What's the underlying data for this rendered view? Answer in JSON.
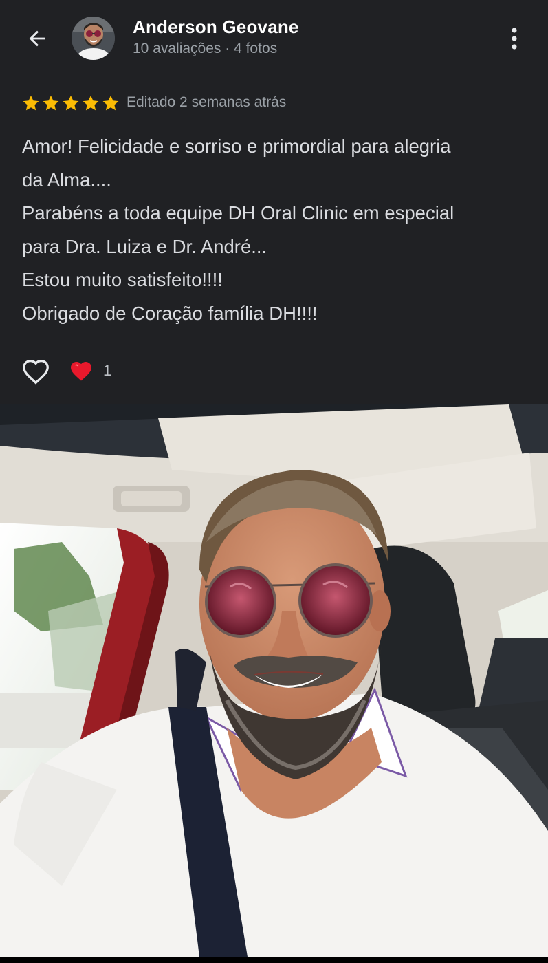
{
  "header": {
    "author_name": "Anderson Geovane",
    "author_meta": "10 avaliações · 4 fotos",
    "back_icon": "arrow-left-icon",
    "more_icon": "more-vertical-icon"
  },
  "rating": {
    "stars": 5,
    "max_stars": 5,
    "edited_label": "Editado 2 semanas atrás",
    "star_color": "#fbbc04"
  },
  "review": {
    "lines": [
      "Amor! Felicidade e sorriso e primordial para alegria",
      "da Alma....",
      "Parabéns a toda equipe DH Oral Clinic em especial",
      "para Dra. Luiza e Dr. André...",
      "Estou muito satisfeito!!!!",
      "Obrigado de Coração família DH!!!!"
    ]
  },
  "reactions": {
    "like_icon": "heart-outline-icon",
    "reaction_icon": "red-heart-icon",
    "count": "1"
  },
  "colors": {
    "panel_background": "#202124",
    "primary_text": "#ffffff",
    "secondary_text": "#9aa0a6",
    "heart_red": "#e8192c"
  }
}
